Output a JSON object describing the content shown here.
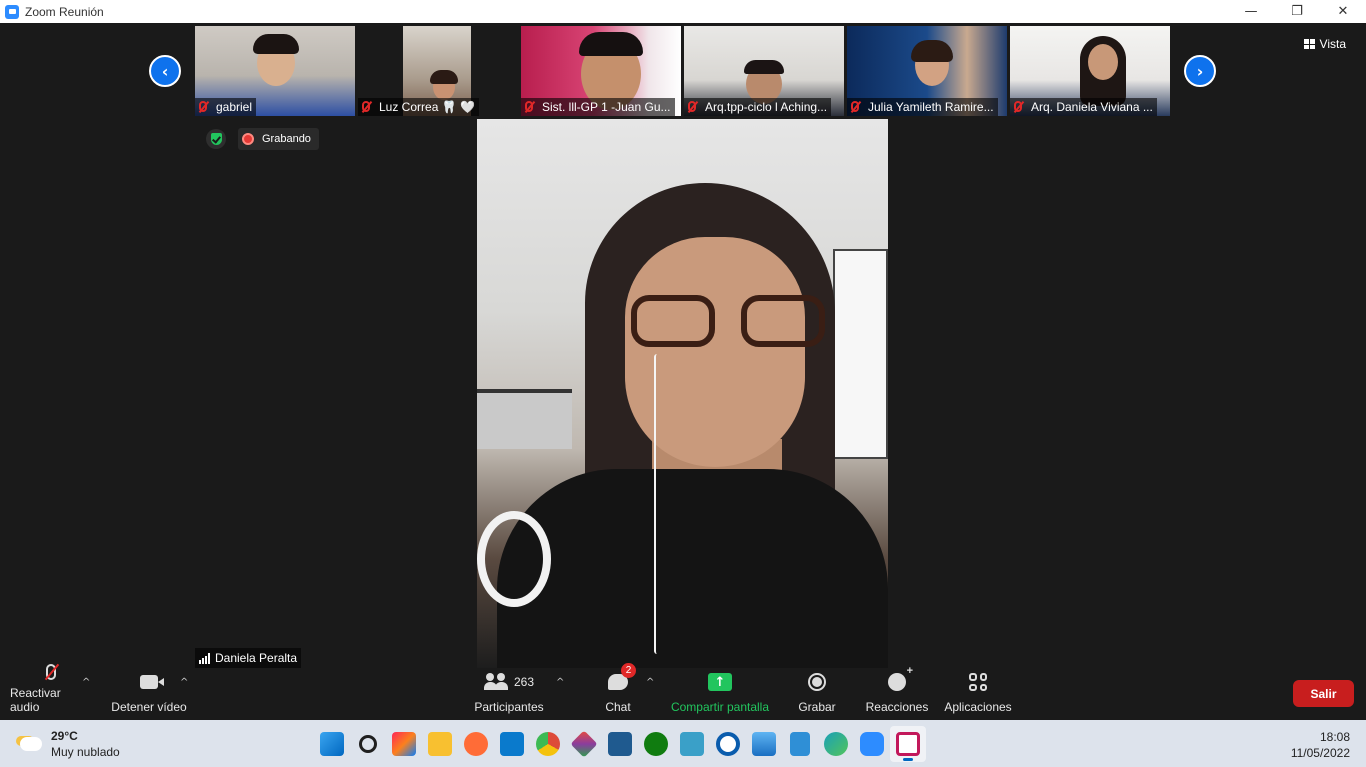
{
  "window": {
    "title": "Zoom Reunión",
    "minimize": "—",
    "restore": "❐",
    "close": "✕"
  },
  "top_bar": {
    "view_label": "Vista",
    "prev_icon": "‹",
    "next_icon": "›"
  },
  "thumbnails": [
    {
      "name": "gabriel"
    },
    {
      "name": "Luz Correa 🦷 🤍"
    },
    {
      "name": "Sist. lll-GP 1 -Juan Gu..."
    },
    {
      "name": "Arq.tpp-ciclo l Aching..."
    },
    {
      "name": "Julia Yamileth Ramire..."
    },
    {
      "name": "Arq. Daniela Viviana ..."
    }
  ],
  "status": {
    "recording_label": "Grabando"
  },
  "active_speaker": {
    "name": "Daniela Peralta"
  },
  "toolbar": {
    "audio_label": "Reactivar audio",
    "video_label": "Detener vídeo",
    "participants_label": "Participantes",
    "participants_count": "263",
    "chat_label": "Chat",
    "chat_badge": "2",
    "share_label": "Compartir pantalla",
    "record_label": "Grabar",
    "reactions_label": "Reacciones",
    "apps_label": "Aplicaciones",
    "leave_label": "Salir",
    "caret": "^",
    "share_arrow": "↑"
  },
  "taskbar": {
    "weather_temp": "29°C",
    "weather_desc": "Muy nublado",
    "time": "18:08",
    "date": "11/05/2022",
    "apps": [
      {
        "icon": "windows-start-icon",
        "color": "#0078d4"
      },
      {
        "icon": "search-icon",
        "color": "#1f1f1f"
      },
      {
        "icon": "intellij-icon",
        "color": "#fe2857"
      },
      {
        "icon": "file-explorer-icon",
        "color": "#f8c030"
      },
      {
        "icon": "postman-icon",
        "color": "#ff6c37"
      },
      {
        "icon": "vscode-icon",
        "color": "#0a7acc"
      },
      {
        "icon": "chrome-icon",
        "color": "#dd4b39"
      },
      {
        "icon": "git-icon",
        "color": "#8a3d9e"
      },
      {
        "icon": "mysql-icon",
        "color": "#1f5a8f"
      },
      {
        "icon": "xbox-icon",
        "color": "#107c10"
      },
      {
        "icon": "help-icon",
        "color": "#3aa0c8"
      },
      {
        "icon": "app-icon",
        "color": "#0a5cad"
      },
      {
        "icon": "photos-icon",
        "color": "#2a82d6"
      },
      {
        "icon": "notepad-icon",
        "color": "#2f8fd6"
      },
      {
        "icon": "edge-icon",
        "color": "#1aa0b8"
      },
      {
        "icon": "zoom-icon",
        "color": "#2d8cff"
      },
      {
        "icon": "snipping-tool-icon",
        "color": "#c2185b"
      }
    ]
  }
}
